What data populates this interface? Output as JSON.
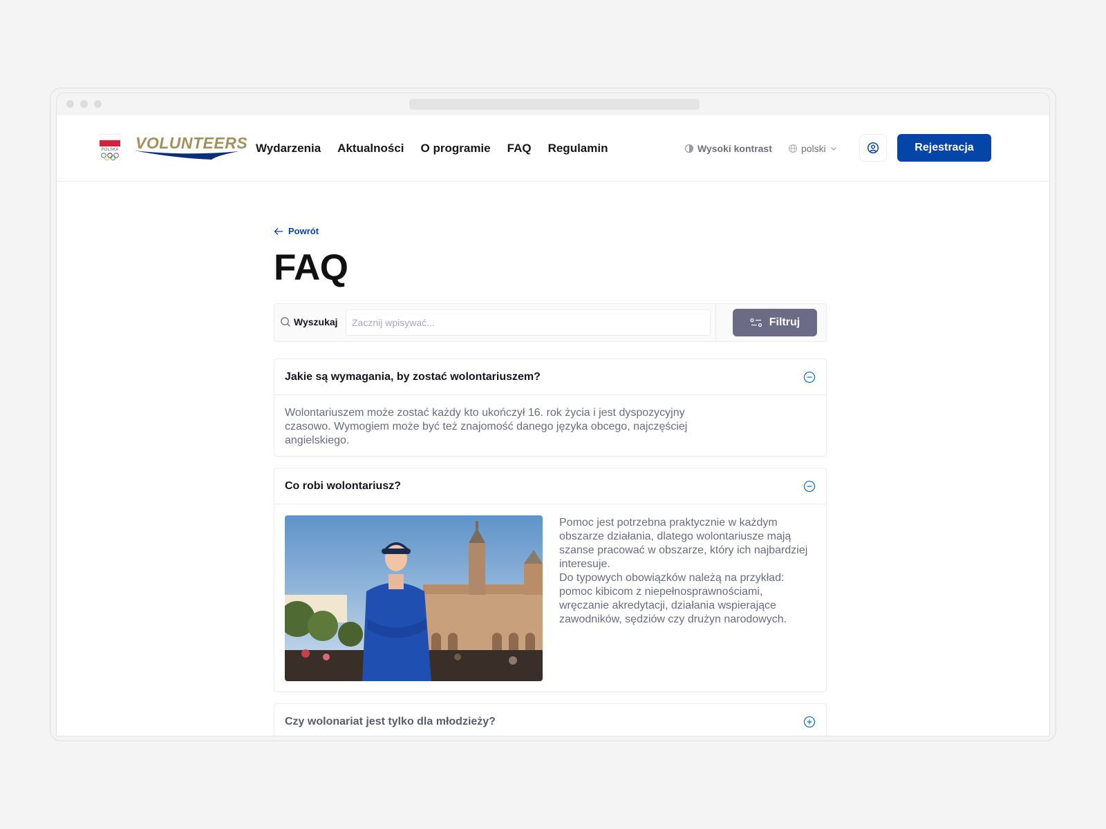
{
  "header": {
    "emblem_text": "POLSKA",
    "logo_text": "VOLUNTEERS",
    "nav": [
      "Wydarzenia",
      "Aktualności",
      "O programie",
      "FAQ",
      "Regulamin"
    ],
    "contrast_label": "Wysoki kontrast",
    "language": "polski",
    "register_label": "Rejestracja"
  },
  "content": {
    "back_label": "Powrót",
    "title": "FAQ",
    "search": {
      "label": "Wyszukaj",
      "placeholder": "Zacznij wpisywać...",
      "filter_label": "Filtruj"
    },
    "faq": [
      {
        "question": "Jakie są wymagania, by zostać wolontariuszem?",
        "answer": "Wolontariuszem może zostać każdy kto ukończył 16. rok życia i jest dyspozycyjny czasowo. Wymogiem może być też znajomość danego języka obcego, najczęściej angielskiego.",
        "expanded": true
      },
      {
        "question": "Co robi wolontariusz?",
        "answer_p1": "Pomoc jest potrzebna praktycznie w każdym obszarze działania, dlatego wolontariusze mają szanse pracować w obszarze, który ich najbardziej interesuje.",
        "answer_p2": "Do typowych obowiązków należą na przykład: pomoc kibicom z niepełnosprawnościami, wręczanie akredytacji, działania wspierające zawodników, sędziów czy drużyn narodowych.",
        "expanded": true
      },
      {
        "question": "Czy wolonariat jest tylko dla młodzieży?",
        "expanded": false
      }
    ]
  },
  "colors": {
    "brand_blue": "#0645a8",
    "filter_gray": "#6b6b85",
    "logo_gold": "#a2915c",
    "icon_blue": "#1a73d1"
  }
}
